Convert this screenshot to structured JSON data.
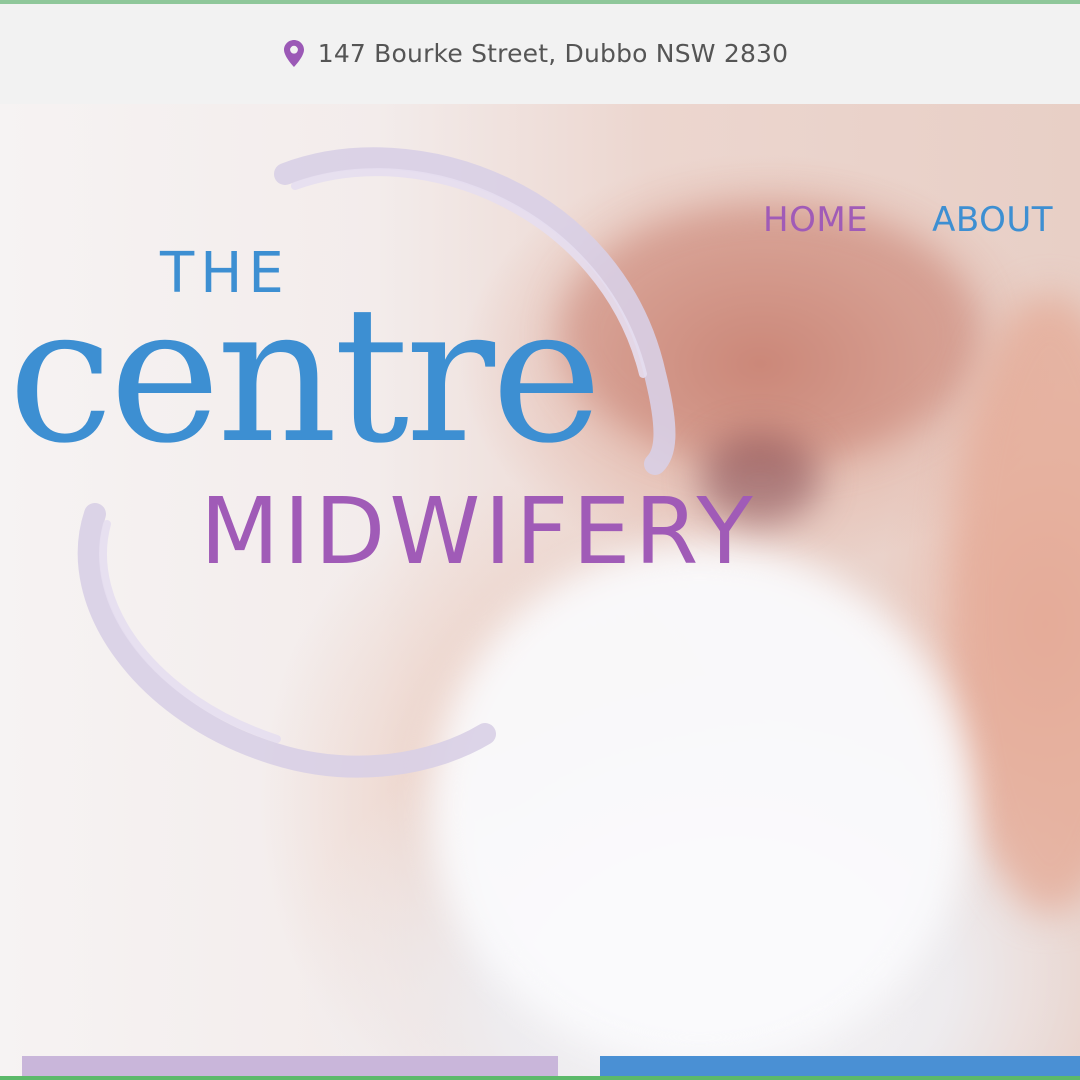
{
  "topbar": {
    "address": "147 Bourke Street, Dubbo NSW 2830",
    "icon": "location-pin-icon"
  },
  "logo": {
    "line1": "THE",
    "line2": "centre",
    "line3": "MIDWIFERY"
  },
  "nav": {
    "items": [
      {
        "label": "HOME",
        "active": true
      },
      {
        "label": "ABOUT"
      }
    ]
  },
  "colors": {
    "brand_blue": "#3d8fd2",
    "brand_purple": "#a05bb7",
    "ring_lavender": "#d8cfe6"
  }
}
